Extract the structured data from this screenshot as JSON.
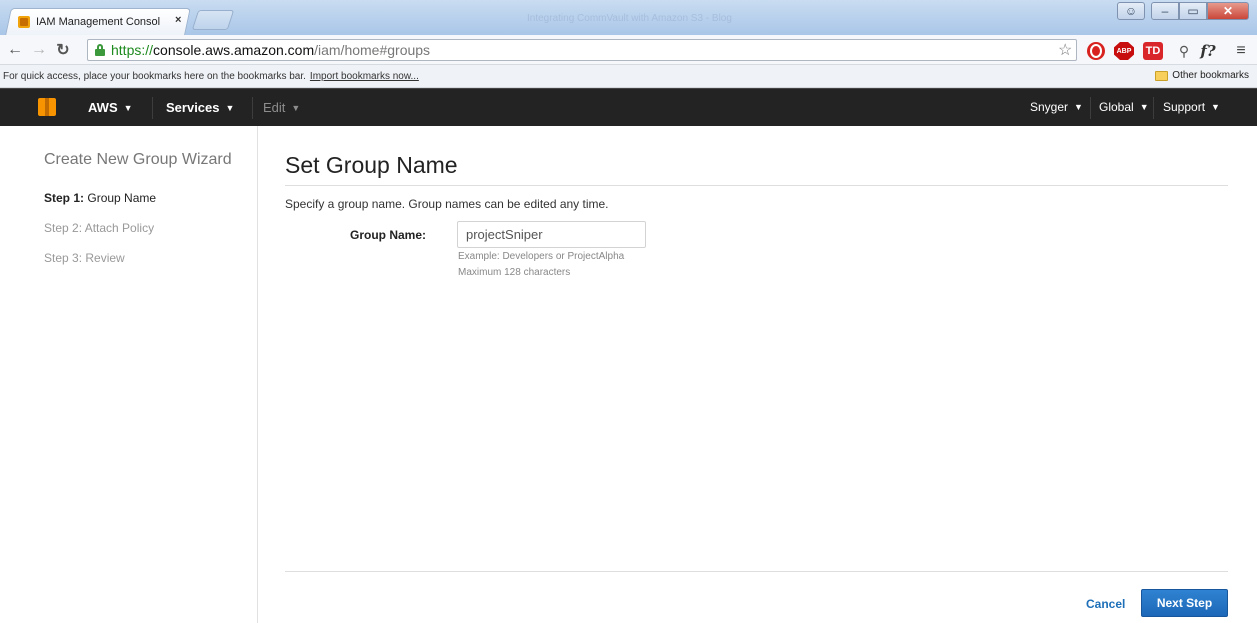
{
  "browser": {
    "tab_title": "IAM Management Consol",
    "tab_close": "×",
    "background_tab_title": "Integrating CommVault with Amazon S3 - Blog",
    "url_scheme": "https://",
    "url_host": "console.aws.amazon.com",
    "url_path": "/iam/home#groups",
    "bookmarks_prompt": "For quick access, place your bookmarks here on the bookmarks bar.",
    "import_link": "Import bookmarks now...",
    "other_bookmarks": "Other bookmarks",
    "extensions": {
      "abp": "ABP",
      "td": "TD",
      "f": "f?"
    }
  },
  "aws_nav": {
    "aws": "AWS",
    "services": "Services",
    "edit": "Edit",
    "user": "Snyger",
    "region": "Global",
    "support": "Support"
  },
  "wizard": {
    "title": "Create New Group Wizard",
    "steps": [
      {
        "num": "Step 1:",
        "label": "Group Name"
      },
      {
        "num": "Step 2:",
        "label": "Attach Policy"
      },
      {
        "num": "Step 3:",
        "label": "Review"
      }
    ]
  },
  "main": {
    "title": "Set Group Name",
    "description": "Specify a group name. Group names can be edited any time.",
    "field_label": "Group Name:",
    "field_value": "projectSniper",
    "hint_example": "Example: Developers or ProjectAlpha",
    "hint_max": "Maximum 128 characters",
    "cancel": "Cancel",
    "next": "Next Step"
  }
}
